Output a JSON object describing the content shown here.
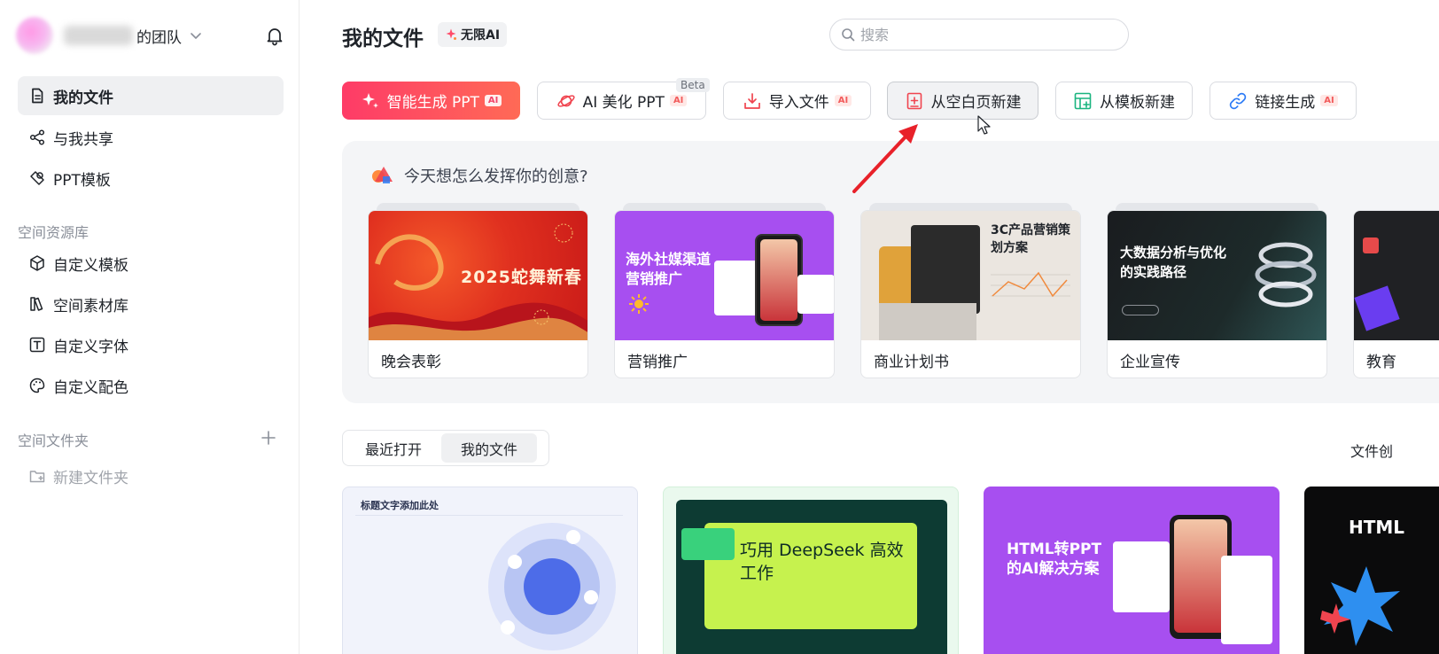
{
  "sidebar": {
    "team_name": "的团队",
    "items": [
      {
        "label": "我的文件"
      },
      {
        "label": "与我共享"
      },
      {
        "label": "PPT模板"
      }
    ],
    "space_library_label": "空间资源库",
    "library_items": [
      {
        "label": "自定义模板"
      },
      {
        "label": "空间素材库"
      },
      {
        "label": "自定义字体"
      },
      {
        "label": "自定义配色"
      }
    ],
    "folder_section_label": "空间文件夹",
    "new_folder_label": "新建文件夹"
  },
  "header": {
    "title": "我的文件",
    "ai_badge": "无限AI",
    "search_placeholder": "搜索"
  },
  "actions": [
    {
      "label": "智能生成 PPT",
      "tag": "AI"
    },
    {
      "label": "AI 美化 PPT",
      "tag": "AI",
      "badge": "Beta"
    },
    {
      "label": "导入文件",
      "tag": "AI"
    },
    {
      "label": "从空白页新建"
    },
    {
      "label": "从模板新建"
    },
    {
      "label": "链接生成",
      "tag": "AI"
    }
  ],
  "inspiration": {
    "prompt": "今天想怎么发挥你的创意?",
    "templates": [
      {
        "label": "晚会表彰",
        "thumb_title": "2025蛇舞新春"
      },
      {
        "label": "营销推广",
        "thumb_title": "海外社媒渠道营销推广"
      },
      {
        "label": "商业计划书",
        "thumb_title": "3C产品营销策划方案"
      },
      {
        "label": "企业宣传",
        "thumb_title": "大数据分析与优化的实践路径"
      },
      {
        "label": "教育"
      }
    ]
  },
  "files": {
    "tabs": [
      {
        "label": "最近打开"
      },
      {
        "label": "我的文件"
      }
    ],
    "sort_label": "文件创",
    "cards": [
      {
        "thumb_title": "标题文字添加此处"
      },
      {
        "thumb_title": "巧用 DeepSeek 高效工作"
      },
      {
        "thumb_title": "HTML转PPT的AI解决方案"
      },
      {
        "thumb_title": "HTML"
      }
    ]
  },
  "colors": {
    "primary_gradient_start": "#fe3b67",
    "primary_gradient_end": "#ff6a56",
    "ai_tag": "#f25b5b",
    "panel_bg": "#f4f5f7",
    "annotation_arrow": "#e8212a"
  }
}
